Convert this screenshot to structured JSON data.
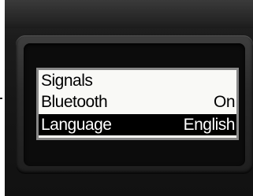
{
  "menu": {
    "items": [
      {
        "label": "Signals",
        "value": ""
      },
      {
        "label": "Bluetooth",
        "value": "On"
      },
      {
        "label": "Language",
        "value": "English"
      }
    ],
    "selected_index": 2
  }
}
